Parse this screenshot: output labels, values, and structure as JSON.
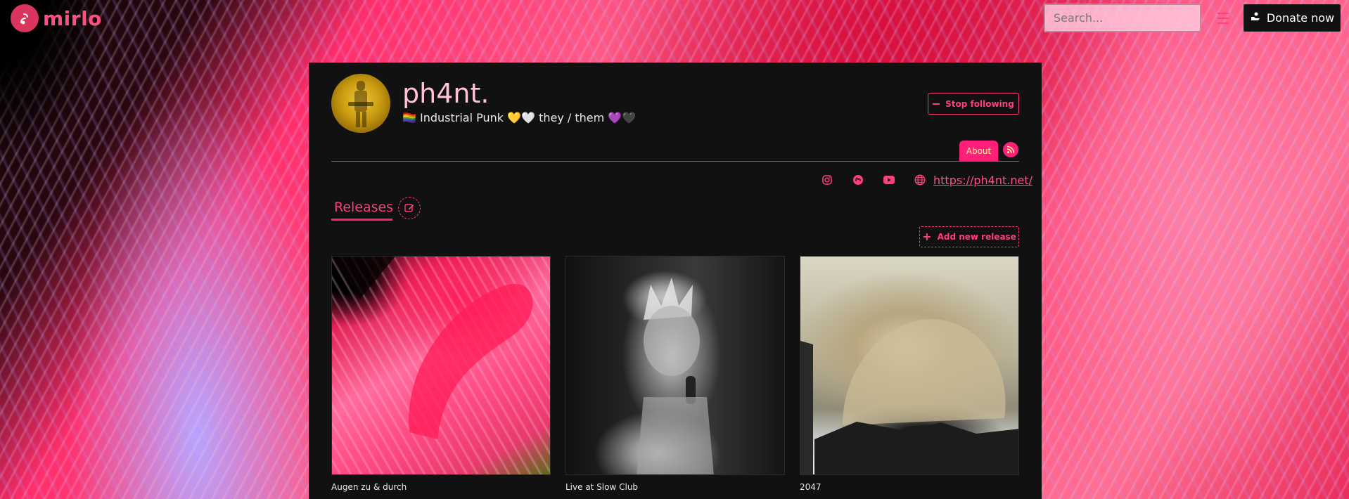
{
  "header": {
    "logo_text": "mirlo",
    "search_placeholder": "Search...",
    "donate_label": "Donate now"
  },
  "artist": {
    "name": "ph4nt.",
    "bio": "🏳️‍🌈 Industrial Punk 💛🤍 they / them 💜🖤",
    "follow_label": "Stop following",
    "tabs": [
      {
        "label": "About"
      }
    ],
    "website": "https://ph4nt.net/",
    "links_icons": [
      "instagram-icon",
      "mastodon-icon",
      "youtube-icon",
      "globe-icon"
    ]
  },
  "releases": {
    "tab_label": "Releases",
    "add_label": "Add new release",
    "items": [
      {
        "title": "Augen zu & durch"
      },
      {
        "title": "Live at Slow Club"
      },
      {
        "title": "2047"
      }
    ]
  },
  "colors": {
    "accent": "#ff1f7a",
    "panel": "#111111",
    "name": "#ffc2da"
  }
}
